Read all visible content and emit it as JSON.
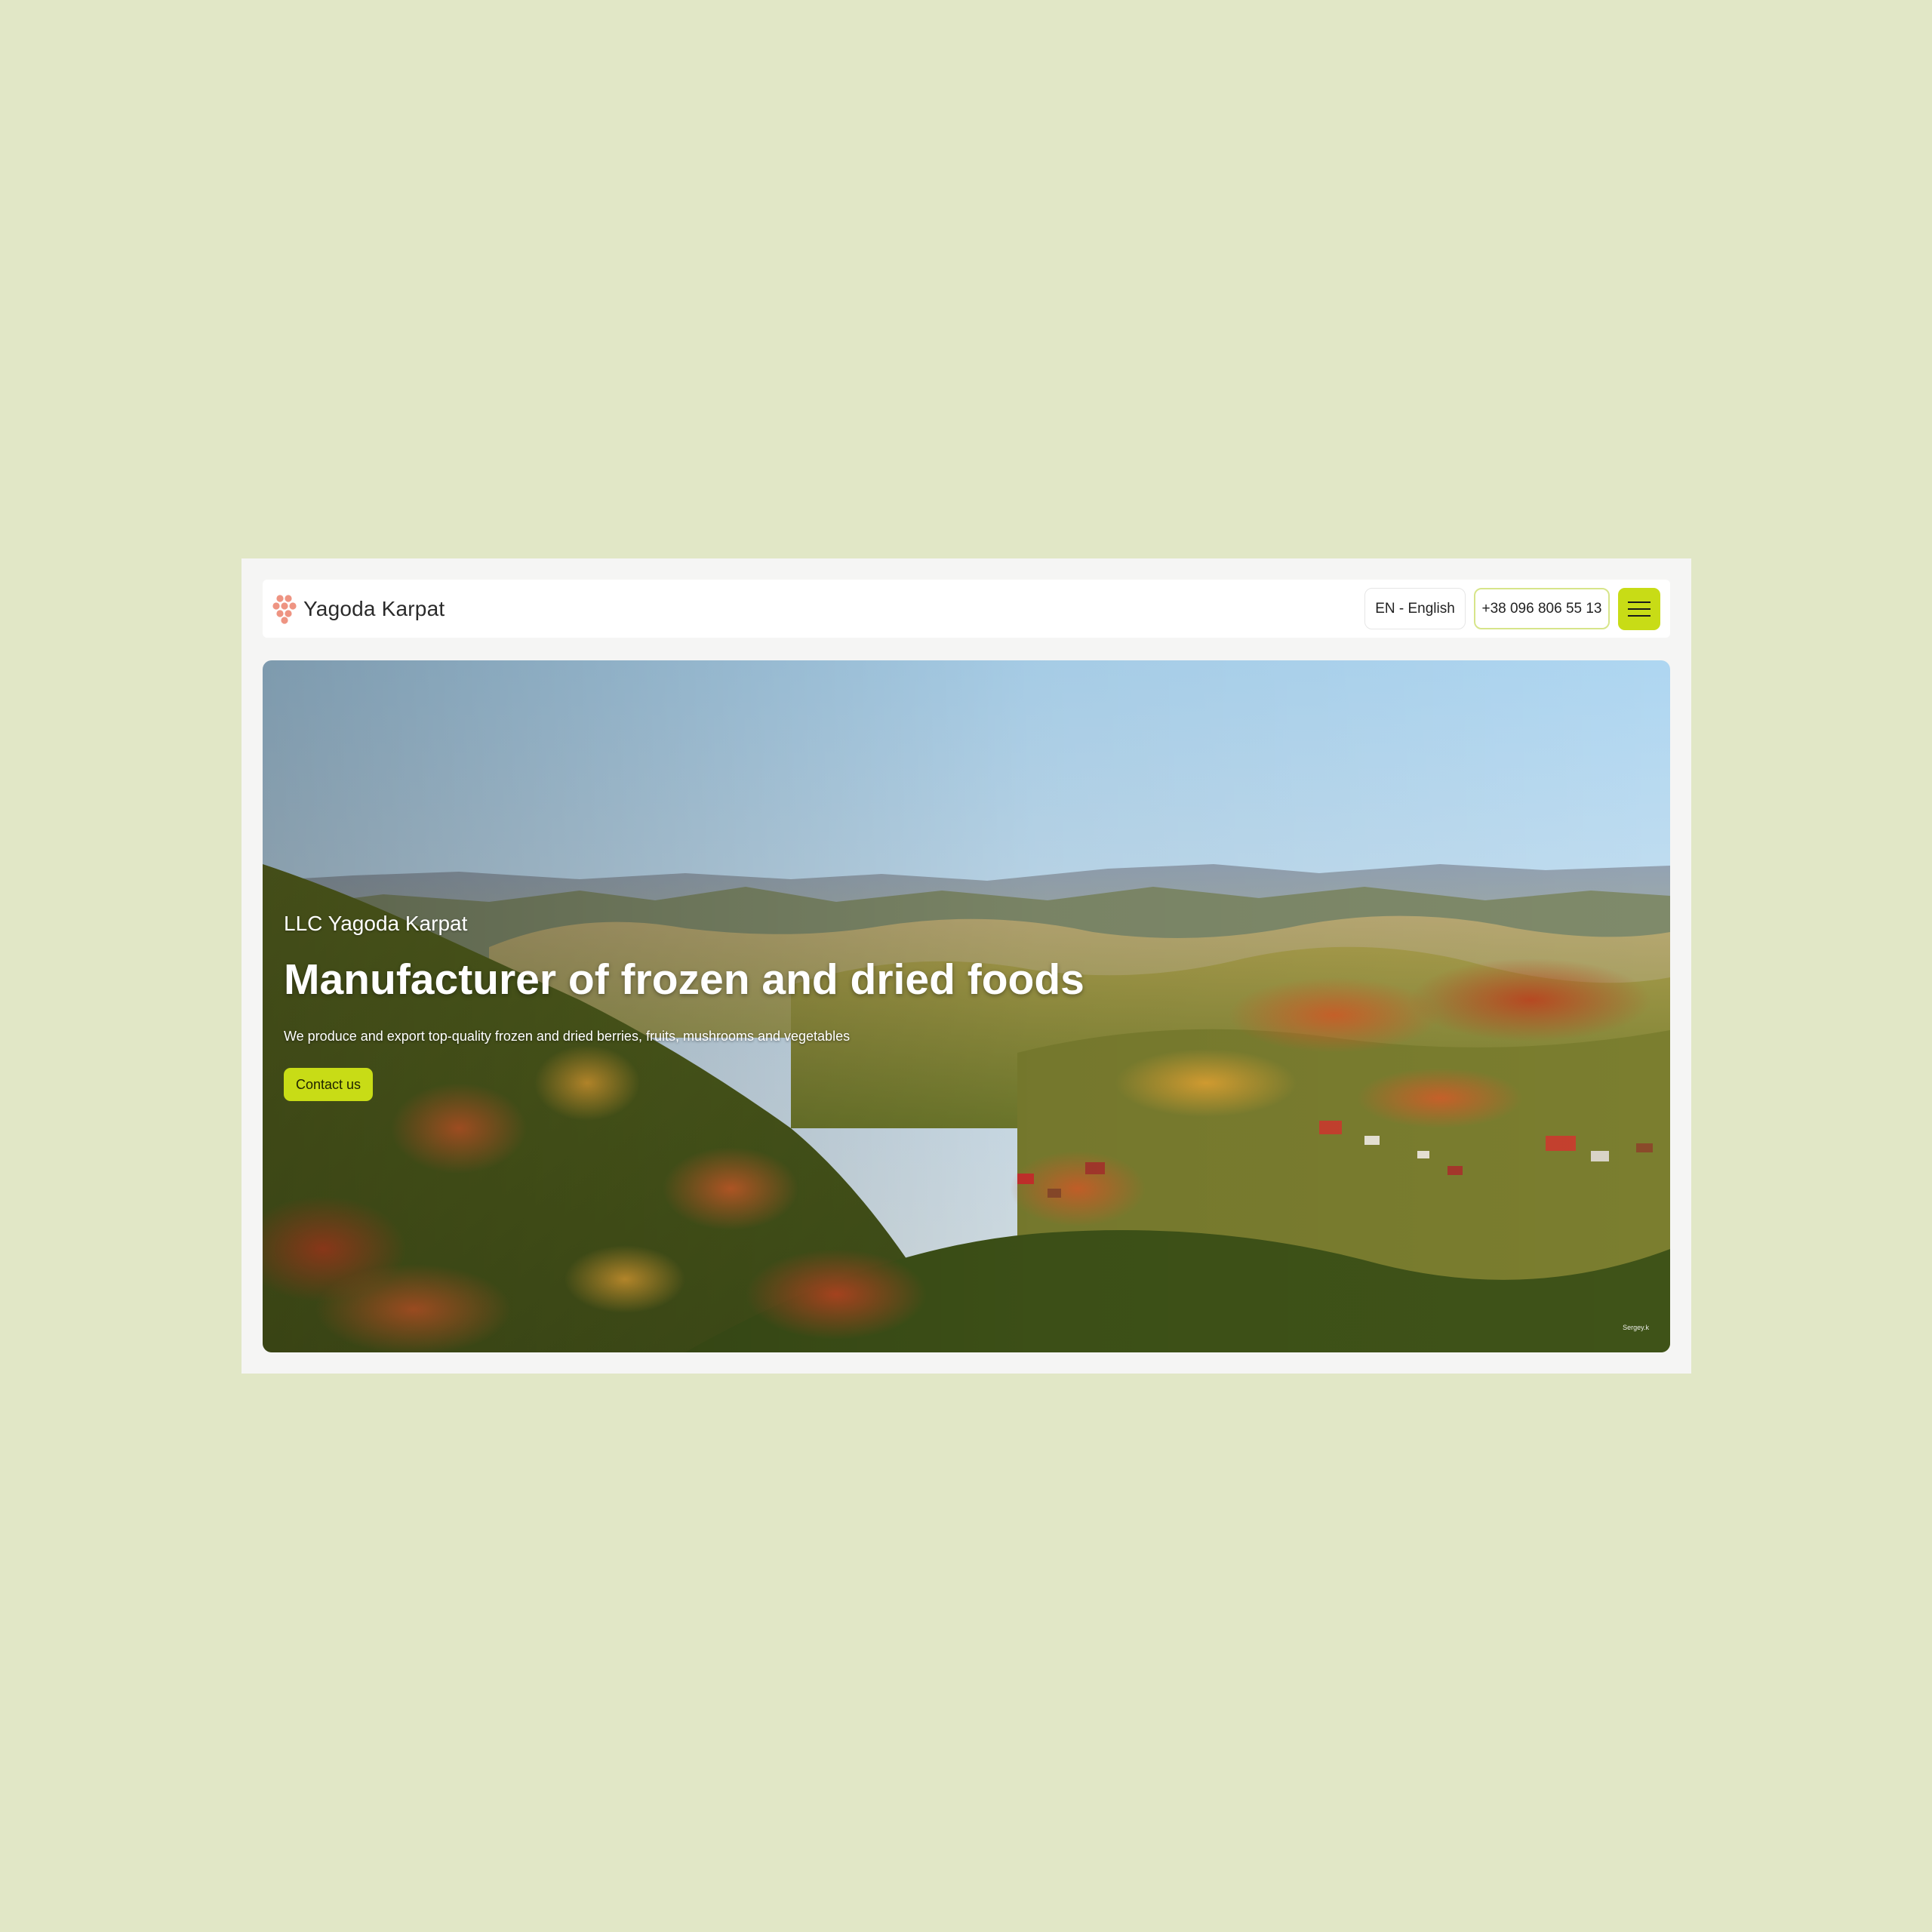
{
  "header": {
    "brand_name": "Yagoda Karpat",
    "language_label": "EN - English",
    "phone_label": "+38 096 806 55 13",
    "menu_icon": "hamburger-menu-icon"
  },
  "hero": {
    "eyebrow": "LLC Yagoda Karpat",
    "headline": "Manufacturer of frozen and dried foods",
    "subline": "We produce and export top-quality frozen and dried berries, fruits, mushrooms and vegetables",
    "cta_label": "Contact us",
    "photo_credit": "Sergey.k",
    "image": "carpathian-mountains-autumn-forest-photo"
  },
  "colors": {
    "page_background": "#e1e7c6",
    "accent": "#c8dc16",
    "logo": "#ee9482",
    "frame": "#f5f5f4"
  }
}
